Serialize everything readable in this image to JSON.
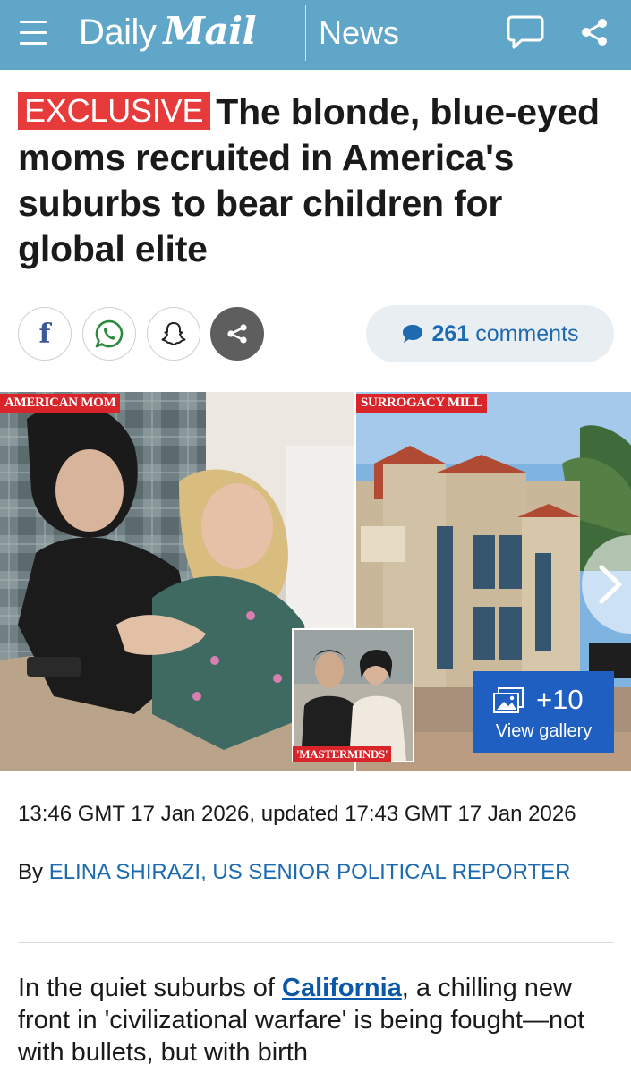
{
  "header": {
    "brand_daily": "Daily",
    "brand_mail": "Mail",
    "section": "News",
    "bar_color": "#5fa6c9"
  },
  "article": {
    "badge": "EXCLUSIVE",
    "headline": "The blonde, blue-eyed moms recruited in America's suburbs to bear children for global elite",
    "share": {
      "facebook_icon": "facebook-icon",
      "whatsapp_icon": "whatsapp-icon",
      "snapchat_icon": "snapchat-icon",
      "more_icon": "share-icon",
      "comments_count": "261",
      "comments_label": "comments"
    },
    "images": {
      "left_label": "AMERICAN MOM",
      "right_label": "SURROGACY MILL",
      "inset_label": "'MASTERMINDS'",
      "gallery_count": "+10",
      "gallery_label": "View gallery"
    },
    "timestamp": "13:46 GMT 17 Jan 2026, updated 17:43 GMT 17 Jan 2026",
    "byline_prefix": "By",
    "author": "ELINA SHIRAZI, US SENIOR POLITICAL REPORTER",
    "body_before_link": "In the quiet suburbs of ",
    "body_link": "California",
    "body_after_link": ", a chilling new front in 'civilizational warfare' is being fought—not with bullets, but with birth"
  },
  "colors": {
    "badge": "#e73a3a",
    "link": "#1d6ab0",
    "gallery_button": "#1f5fc2",
    "label_tag": "#d9242a"
  }
}
